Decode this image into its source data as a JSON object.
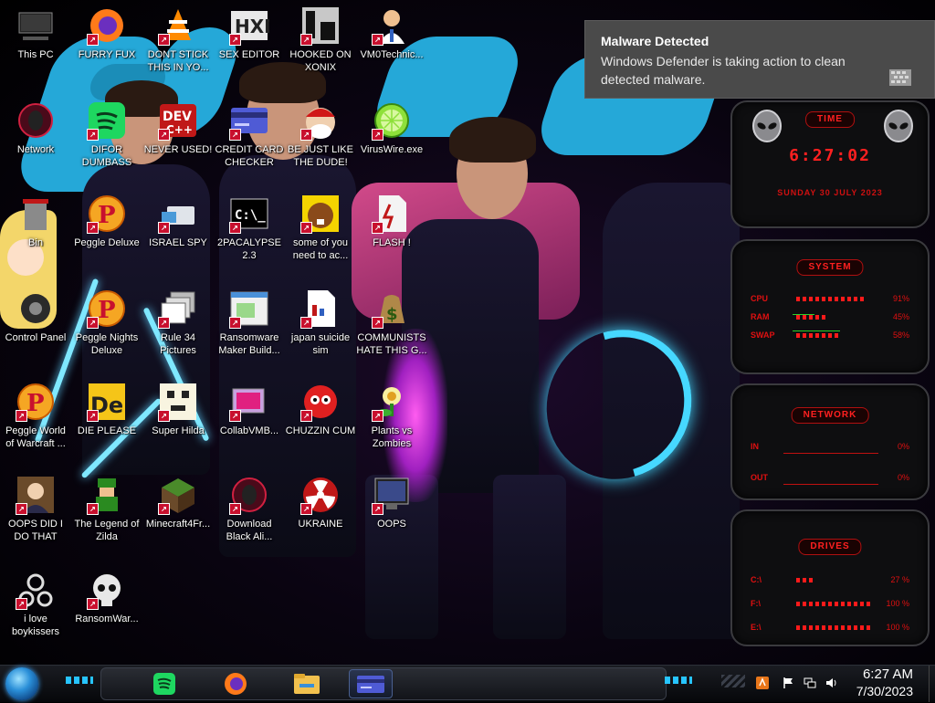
{
  "desktop": {
    "icons": [
      {
        "label": "This PC",
        "glyph": "pc-icon"
      },
      {
        "label": "FURRY FUX",
        "glyph": "firefox-icon"
      },
      {
        "label": "DONT STICK THIS IN YO...",
        "glyph": "vlc-icon"
      },
      {
        "label": "SEX EDITOR",
        "glyph": "hxd-icon"
      },
      {
        "label": "HOOKED ON XONIX",
        "glyph": "xonix-icon"
      },
      {
        "label": "VM0Technic...",
        "glyph": "doctor-icon"
      },
      {
        "label": "Network",
        "glyph": "alien-globe-icon"
      },
      {
        "label": "DIFOR DUMBASS",
        "glyph": "spotify-icon"
      },
      {
        "label": "NEVER USED!",
        "glyph": "devcpp-icon"
      },
      {
        "label": "CREDIT CARD CHECKER",
        "glyph": "credit-card-icon"
      },
      {
        "label": "BE JUST LIKE THE DUDE!",
        "glyph": "santa-icon"
      },
      {
        "label": "VirusWire.exe",
        "glyph": "lime-icon"
      },
      {
        "label": "Bin",
        "glyph": "recycle-bin-icon"
      },
      {
        "label": "Peggle Deluxe",
        "glyph": "peggle-icon"
      },
      {
        "label": "ISRAEL SPY",
        "glyph": "spy-icon"
      },
      {
        "label": "2PACALYPSE 2.3",
        "glyph": "terminal-icon"
      },
      {
        "label": "some of you need to ac...",
        "glyph": "beaver-icon"
      },
      {
        "label": "FLASH !",
        "glyph": "flash-doc-icon"
      },
      {
        "label": "Control Panel",
        "glyph": "control-panel-icon"
      },
      {
        "label": "Peggle Nights Deluxe",
        "glyph": "peggle-icon"
      },
      {
        "label": "Rule 34 Pictures",
        "glyph": "stack-icon"
      },
      {
        "label": "Ransomware Maker Build...",
        "glyph": "window-icon"
      },
      {
        "label": "japan suicide sim",
        "glyph": "doc-icon"
      },
      {
        "label": "COMMUNISTS HATE THIS G...",
        "glyph": "money-bag-icon"
      },
      {
        "label": "Peggle World of Warcraft ...",
        "glyph": "peggle-icon"
      },
      {
        "label": "DIE PLEASE",
        "glyph": "de-icon"
      },
      {
        "label": "Super Hilda",
        "glyph": "pixel-icon"
      },
      {
        "label": "CollabVMB...",
        "glyph": "collab-icon"
      },
      {
        "label": "CHUZZIN CUM",
        "glyph": "chuzzle-icon"
      },
      {
        "label": "Plants vs Zombies",
        "glyph": "plant-icon"
      },
      {
        "label": "OOPS DID I DO THAT",
        "glyph": "portrait-icon"
      },
      {
        "label": "The Legend of Zilda",
        "glyph": "zelda-icon"
      },
      {
        "label": "Minecraft4Fr...",
        "glyph": "minecraft-icon"
      },
      {
        "label": "Download Black Ali...",
        "glyph": "alien-globe-icon"
      },
      {
        "label": "UKRAINE",
        "glyph": "radiation-icon"
      },
      {
        "label": "OOPS",
        "glyph": "monitor-icon"
      },
      {
        "label": "i love boykissers",
        "glyph": "network-node-icon"
      },
      {
        "label": "RansomWar...",
        "glyph": "skull-icon"
      }
    ]
  },
  "toast": {
    "title": "Malware Detected",
    "body": "Windows Defender is taking action to clean detected malware."
  },
  "gadget": {
    "time_title": "TIME",
    "time": "6:27:02",
    "date": "SUNDAY 30 JULY 2023",
    "system_title": "SYSTEM",
    "system": [
      {
        "label": "CPU",
        "value": "91%",
        "level": 0.91
      },
      {
        "label": "RAM",
        "value": "45%",
        "level": 0.45
      },
      {
        "label": "SWAP",
        "value": "58%",
        "level": 0.58
      }
    ],
    "network_title": "NETWORK",
    "network": [
      {
        "label": "IN",
        "value": "0%"
      },
      {
        "label": "OUT",
        "value": "0%"
      }
    ],
    "drives_title": "DRIVES",
    "drives": [
      {
        "label": "C:\\",
        "value": "27 %",
        "level": 0.27
      },
      {
        "label": "F:\\",
        "value": "100 %",
        "level": 1.0
      },
      {
        "label": "E:\\",
        "value": "100 %",
        "level": 1.0
      }
    ],
    "accent": "#ff1a1a"
  },
  "taskbar": {
    "pinned": [
      {
        "name": "spotify-icon",
        "active": false
      },
      {
        "name": "firefox-icon",
        "active": false
      },
      {
        "name": "file-explorer-icon",
        "active": false
      },
      {
        "name": "credit-card-icon",
        "active": true
      }
    ],
    "clock_time": "6:27 AM",
    "clock_date": "7/30/2023"
  }
}
